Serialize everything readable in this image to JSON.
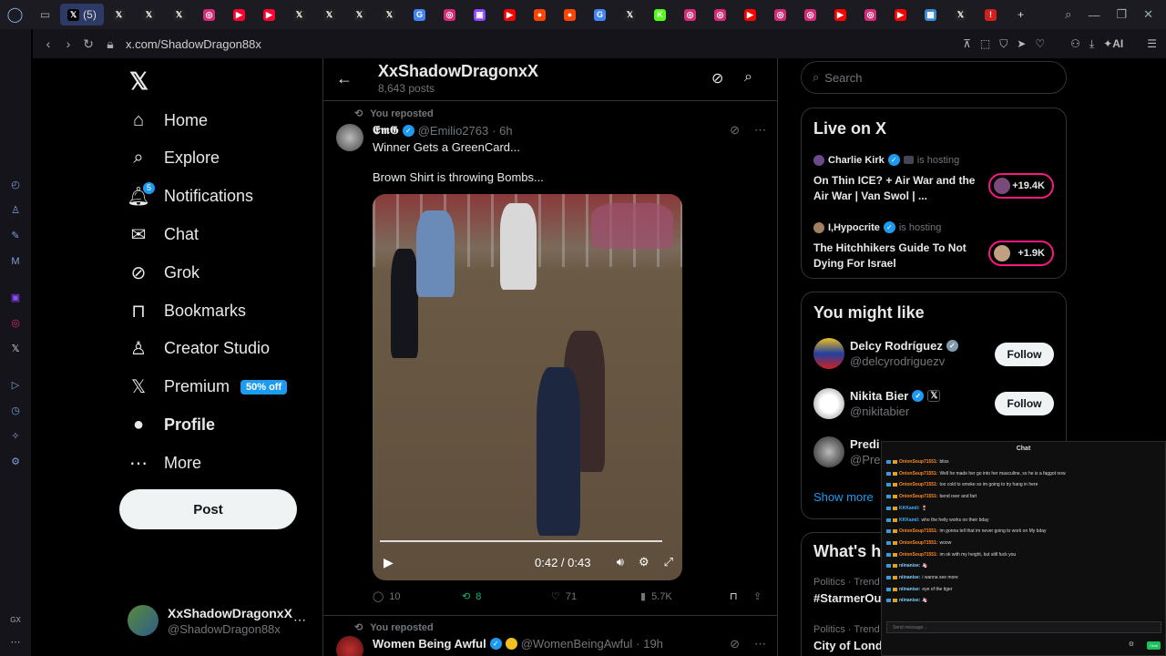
{
  "browser": {
    "active_tab_label": "(5)",
    "url": "x.com/ShadowDragon88x",
    "ai_label": "AI",
    "gx_label": "GX",
    "tabs": [
      {
        "icon": "x-icon",
        "color": "#222222"
      },
      {
        "icon": "x-icon",
        "color": "#222222"
      },
      {
        "icon": "x-icon",
        "color": "#222222"
      },
      {
        "icon": "instagram-icon",
        "color": "#d62976"
      },
      {
        "icon": "youtube-shorts-icon",
        "color": "#ff0033"
      },
      {
        "icon": "youtube-shorts-icon",
        "color": "#ff0033"
      },
      {
        "icon": "x-icon",
        "color": "#222222"
      },
      {
        "icon": "x-icon",
        "color": "#222222"
      },
      {
        "icon": "x-icon",
        "color": "#222222"
      },
      {
        "icon": "x-icon",
        "color": "#222222"
      },
      {
        "icon": "google-icon",
        "color": "#4285f4"
      },
      {
        "icon": "instagram-icon",
        "color": "#d62976"
      },
      {
        "icon": "twitch-icon",
        "color": "#9146ff"
      },
      {
        "icon": "youtube-icon",
        "color": "#ff0000"
      },
      {
        "icon": "reddit-icon",
        "color": "#ff4500"
      },
      {
        "icon": "reddit-icon",
        "color": "#ff4500"
      },
      {
        "icon": "google-icon",
        "color": "#4285f4"
      },
      {
        "icon": "x-icon",
        "color": "#222222"
      },
      {
        "icon": "kick-icon",
        "color": "#53fc18"
      },
      {
        "icon": "instagram-icon",
        "color": "#d62976"
      },
      {
        "icon": "instagram-icon",
        "color": "#d62976"
      },
      {
        "icon": "youtube-icon",
        "color": "#ff0000"
      },
      {
        "icon": "instagram-icon",
        "color": "#d62976"
      },
      {
        "icon": "instagram-icon",
        "color": "#d62976"
      },
      {
        "icon": "youtube-icon",
        "color": "#ff0000"
      },
      {
        "icon": "instagram-icon",
        "color": "#d62976"
      },
      {
        "icon": "youtube-icon",
        "color": "#ff0000"
      },
      {
        "icon": "picture-icon",
        "color": "#3a8ad0"
      },
      {
        "icon": "x-icon",
        "color": "#222222"
      },
      {
        "icon": "alert-icon",
        "color": "#d02020"
      }
    ]
  },
  "nav": {
    "items": [
      {
        "label": "Home",
        "icon": "home-icon"
      },
      {
        "label": "Explore",
        "icon": "search-icon"
      },
      {
        "label": "Notifications",
        "icon": "bell-icon",
        "badge": "5"
      },
      {
        "label": "Chat",
        "icon": "mail-icon"
      },
      {
        "label": "Grok",
        "icon": "grok-icon"
      },
      {
        "label": "Bookmarks",
        "icon": "bookmark-icon"
      },
      {
        "label": "Creator Studio",
        "icon": "creator-icon"
      },
      {
        "label": "Premium",
        "icon": "x-premium-icon",
        "promo": "50% off"
      },
      {
        "label": "Profile",
        "icon": "person-icon"
      },
      {
        "label": "More",
        "icon": "more-circle-icon"
      }
    ],
    "post_label": "Post",
    "account": {
      "name": "XxShadowDragonxX",
      "handle": "@ShadowDragon88x"
    }
  },
  "profile_header": {
    "name": "XxShadowDragonxX",
    "posts": "8,643 posts"
  },
  "tweets": [
    {
      "repost_label": "You reposted",
      "name": "𝕰𝖒𝕲",
      "handle": "@Emilio2763",
      "time": "· 6h",
      "text1": "Winner Gets a GreenCard...",
      "text2": "Brown Shirt is throwing Bombs...",
      "video": {
        "time": "0:42 / 0:43",
        "progress_fraction": 0.98
      },
      "stats": {
        "replies": "10",
        "reposts": "8",
        "likes": "71",
        "views": "5.7K"
      }
    },
    {
      "repost_label": "You reposted",
      "name": "Women Being Awful",
      "handle": "@WomenBeingAwful",
      "time": "· 19h"
    }
  ],
  "right": {
    "search_placeholder": "Search",
    "live": {
      "title": "Live on X",
      "spaces": [
        {
          "host": "Charlie Kirk",
          "hosting": "is hosting",
          "title": "On Thin ICE? + Air War and the Air War | Van Swol | ...",
          "listeners": "+19.4K"
        },
        {
          "host": "I,Hypocrite",
          "hosting": "is hosting",
          "title": "The Hitchhikers Guide To Not Dying For Israel",
          "listeners": "+1.9K"
        }
      ]
    },
    "wtf": {
      "title": "You might like",
      "people": [
        {
          "name": "Delcy Rodríguez",
          "handle": "@delcyrodriguezv",
          "follow": "Follow"
        },
        {
          "name": "Nikita Bier",
          "handle": "@nikitabier",
          "follow": "Follow"
        },
        {
          "name": "Predi",
          "handle": "@Pre"
        }
      ],
      "show_more": "Show more"
    },
    "trends": {
      "title": "What's ha",
      "items": [
        {
          "meta": "Politics · Trend",
          "name": "#StarmerOu"
        },
        {
          "meta": "Politics · Trend",
          "name": "City of Lond"
        }
      ]
    }
  },
  "chat": {
    "title": "Chat",
    "messages": [
      {
        "user": "OnionSoup71551:",
        "text": "bliss",
        "color": "#ff8a1a"
      },
      {
        "user": "OnionSoup71551:",
        "text": "Well he made her go into her masculine, so he is a faggot now",
        "color": "#ff8a1a"
      },
      {
        "user": "OnionSoup71551:",
        "text": "too cold to smoke so im going to try hang in here",
        "color": "#ff8a1a"
      },
      {
        "user": "OnionSoup71551:",
        "text": "bend over and fart",
        "color": "#ff8a1a"
      },
      {
        "user": "KKKamil:",
        "text": "🍷",
        "color": "#3ab0ff"
      },
      {
        "user": "KKKamil:",
        "text": "who the heily works on their bday",
        "color": "#3ab0ff"
      },
      {
        "user": "OnionSoup71551:",
        "text": "im gonna tell that im never going to work on My bday",
        "color": "#ff8a1a"
      },
      {
        "user": "OnionSoup71551:",
        "text": "woow",
        "color": "#ff8a1a"
      },
      {
        "user": "OnionSoup71551:",
        "text": "im ok with my height, but still fuck you",
        "color": "#ff8a1a"
      },
      {
        "user": "niinanise:",
        "text": "🦄",
        "color": "#7fd0ff"
      },
      {
        "user": "niinanise:",
        "text": "i wanna see more",
        "color": "#7fd0ff"
      },
      {
        "user": "niinanise:",
        "text": "eye of the tiger",
        "color": "#7fd0ff"
      },
      {
        "user": "niinanise:",
        "text": "🦄",
        "color": "#7fd0ff"
      }
    ],
    "input_placeholder": "Send message...",
    "send_label": "Chat"
  }
}
